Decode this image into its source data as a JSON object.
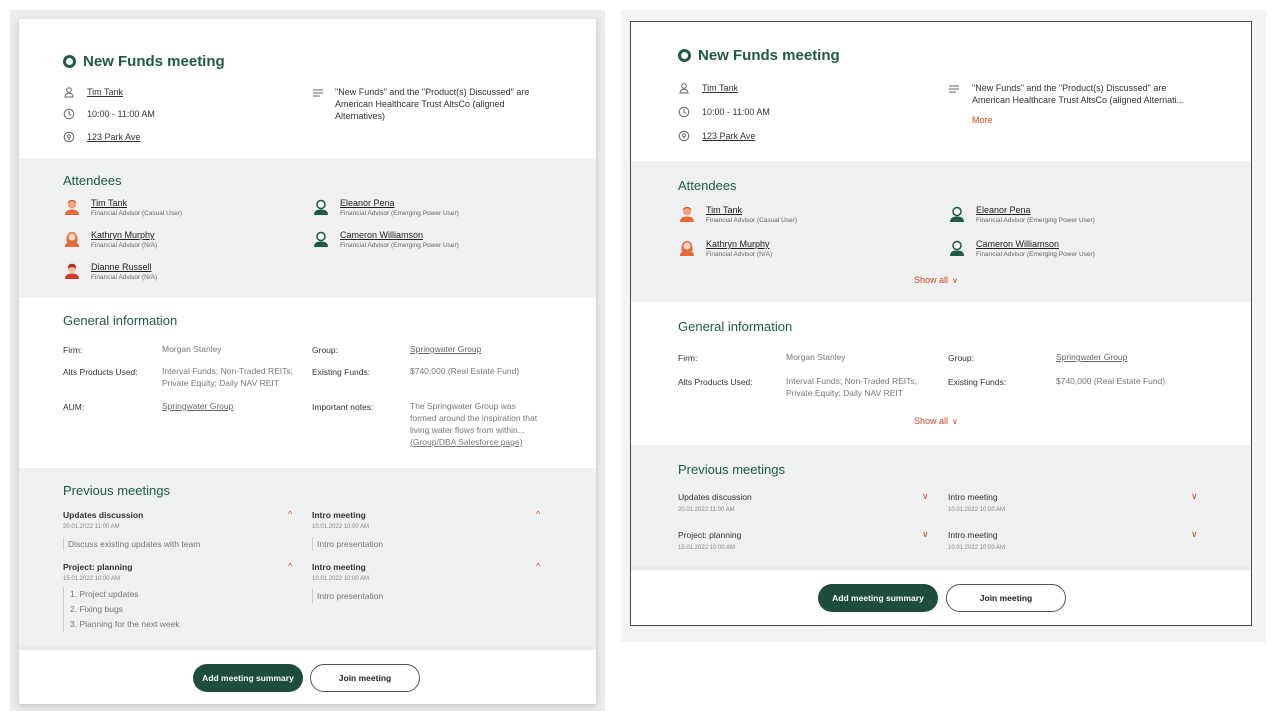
{
  "colors": {
    "brand": "#1f5a45",
    "accent": "#d2461e",
    "section_bg": "#eef0f1",
    "button": "#1e4d3c"
  },
  "left": {
    "title": "New Funds meeting",
    "owner": "Tim Tank",
    "time": "10:00 - 11:00 AM",
    "location": "123 Park Ave",
    "note": [
      "\"New Funds\" and the \"Product(s) Discussed\" are",
      "American Healthcare Trust AltsCo (aligned",
      "Alternatives)"
    ],
    "attendees_heading": "Attendees",
    "attendees": [
      {
        "name": "Tim Tank",
        "role": "Financial Advisor (Casual User)"
      },
      {
        "name": "Eleanor Pena",
        "role": "Financial Advisor (Emerging Power User)"
      },
      {
        "name": "Kathryn Murphy",
        "role": "Financial Advisor (N/A)"
      },
      {
        "name": "Cameron Williamson",
        "role": "Financial Advisor (Emerging Power User)"
      },
      {
        "name": "Dianne Russell",
        "role": "Financial Advisor (N/A)"
      }
    ],
    "general_heading": "General information",
    "general": {
      "firm_label": "Firm:",
      "firm_value": "Morgan Stanley",
      "group_label": "Group:",
      "group_value": "Springwater Group",
      "alts_label": "Alts Products Used:",
      "alts_value": [
        "Interval Funds; Non-Traded REITs;",
        "Private Equity; Daily NAV REIT"
      ],
      "existing_label": "Existing Funds:",
      "existing_value": "$740,000 (Real Estate Fund)",
      "aum_label": "AUM:",
      "aum_value": "Springwater Group",
      "notes_label": "Important notes:",
      "notes_value": [
        "The Springwater Group was",
        "formed around the inspiration that",
        "living water flows from within..."
      ],
      "notes_link": "(Group/DBA Salesforce page)"
    },
    "previous_heading": "Previous meetings",
    "meetings": [
      {
        "title": "Updates discussion",
        "date": "20.01.2022   11:00 AM",
        "desc": "Discuss existing updates with team"
      },
      {
        "title": "Intro meeting",
        "date": "10.01.2022   10:00 AM",
        "desc": "Intro presentation"
      },
      {
        "title": "Project: planning",
        "date": "15.01.2022   10:00 AM",
        "items": [
          "1. Project updates",
          "2. Fixing bugs",
          "3. Planning for the next week"
        ]
      },
      {
        "title": "Intro meeting",
        "date": "10.01.2022   10:00 AM",
        "desc": "Intro presentation"
      }
    ],
    "add_summary": "Add meeting summary",
    "join": "Join meeting"
  },
  "right": {
    "title": "New Funds meeting",
    "owner": "Tim Tank",
    "time": "10:00 - 11:00 AM",
    "location": "123 Park Ave",
    "note": [
      "\"New Funds\" and the \"Product(s) Discussed\" are",
      "American Healthcare Trust AltsCo (aligned Alternati..."
    ],
    "more": "More",
    "attendees_heading": "Attendees",
    "attendees": [
      {
        "name": "Tim Tank",
        "role": "Financial Advisor (Casual User)"
      },
      {
        "name": "Eleanor Pena",
        "role": "Financial Advisor (Emerging Power User)"
      },
      {
        "name": "Kathryn Murphy",
        "role": "Financial Advisor (N/A)"
      },
      {
        "name": "Cameron Williamson",
        "role": "Financial Advisor (Emerging Power User)"
      }
    ],
    "show_all": "Show all",
    "general_heading": "General information",
    "general": {
      "firm_label": "Firm:",
      "firm_value": "Morgan Stanley",
      "group_label": "Group:",
      "group_value": "Springwater Group",
      "alts_label": "Alts Products Used:",
      "alts_value": [
        "Interval Funds; Non-Traded REITs;",
        "Private Equity; Daily NAV REIT"
      ],
      "existing_label": "Existing Funds:",
      "existing_value": "$740,000 (Real Estate Fund)"
    },
    "previous_heading": "Previous meetings",
    "meetings": [
      {
        "title": "Updates discussion",
        "date": "20.01.2022   11:00 AM"
      },
      {
        "title": "Intro meeting",
        "date": "10.01.2022   10:00 AM"
      },
      {
        "title": "Project: planning",
        "date": "15.01.2022   10:00 AM"
      },
      {
        "title": "Intro meeting",
        "date": "10.01.2022   10:00 AM"
      }
    ],
    "add_summary": "Add meeting summary",
    "join": "Join meeting"
  }
}
